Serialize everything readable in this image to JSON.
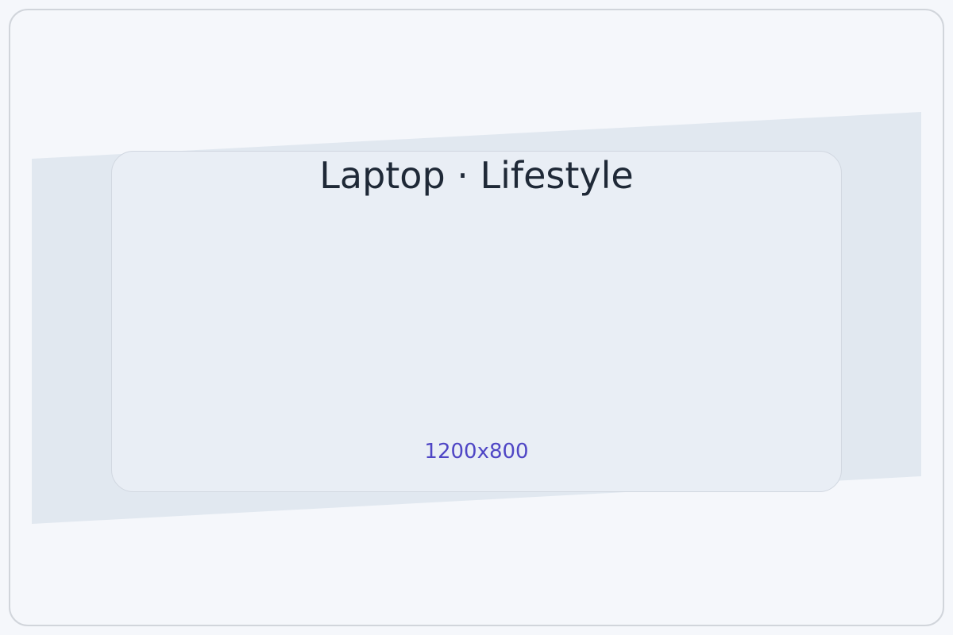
{
  "placeholder": {
    "title": "Laptop · Lifestyle",
    "dimensions": "1200x800"
  },
  "colors": {
    "page_background": "#f5f7fb",
    "backdrop_band": "#e1e8f0",
    "card_background": "#e9eef5",
    "title_text": "#1f2937",
    "dimensions_text": "#4f46c5"
  }
}
